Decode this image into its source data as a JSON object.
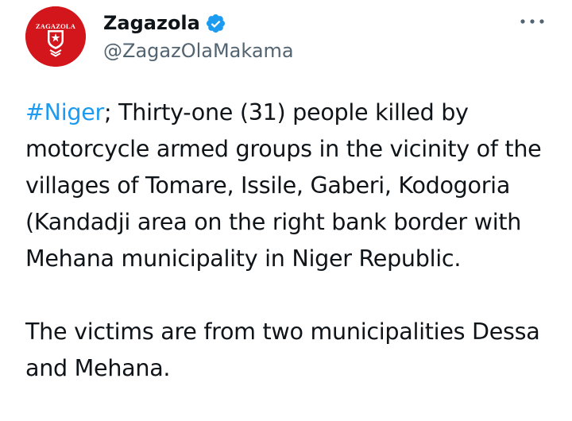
{
  "author": {
    "display_name": "Zagazola",
    "handle": "@ZagazOlaMakama",
    "avatar_text": "ZAGAZOLA",
    "verified_icon": "verified-badge-icon",
    "more_icon": "more-horizontal-icon"
  },
  "tweet": {
    "hashtag": "#Niger",
    "text_after_hashtag": "; Thirty-one (31) people killed by motorcycle armed groups in the vicinity of the villages of Tomare, Issile, Gaberi, Kodogoria (Kandadji area on the right bank border with Mehana municipality in Niger Republic.",
    "paragraph_2": "The victims are from two municipalities Dessa and Mehana."
  },
  "colors": {
    "text": "#0f1419",
    "secondary": "#536471",
    "link": "#1d9bf0",
    "avatar_bg": "#d3161b",
    "verified": "#1d9bf0"
  }
}
